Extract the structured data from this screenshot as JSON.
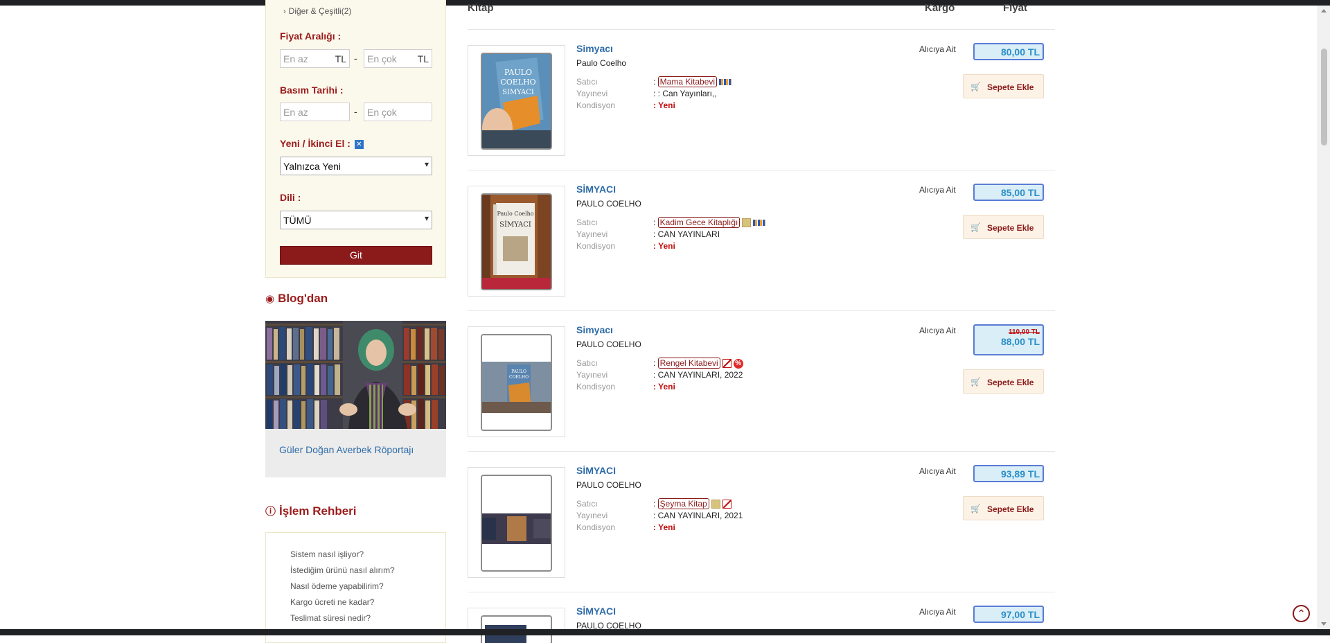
{
  "sidebar": {
    "category_link": "Diğer & Çeşitli(2)",
    "price_label": "Fiyat Aralığı :",
    "price_min_placeholder": "En az",
    "price_max_placeholder": "En çok",
    "currency": "TL",
    "dash": "-",
    "year_label": "Basım Tarihi :",
    "year_min_placeholder": "En az",
    "year_max_placeholder": "En çok",
    "condition_label": "Yeni / İkinci El :",
    "condition_selected": "Yalnızca Yeni",
    "language_label": "Dili :",
    "language_selected": "TÜMÜ",
    "go_button": "Git"
  },
  "blog": {
    "title": "Blog'dan",
    "caption": "Güler Doğan Averbek Röportajı"
  },
  "guide": {
    "title": "İşlem Rehberi",
    "items": [
      "Sistem nasıl işliyor?",
      "İstediğim ürünü nasıl alırım?",
      "Nasıl ödeme yapabilirim?",
      "Kargo ücreti ne kadar?",
      "Teslimat süresi nedir?"
    ]
  },
  "results": {
    "headers": {
      "book": "Kitap",
      "cargo": "Kargo",
      "price": "Fiyat"
    },
    "meta_keys": {
      "seller": "Satıcı",
      "publisher": "Yayınevi",
      "condition": "Kondisyon"
    },
    "cart_label": "Sepete Ekle",
    "items": [
      {
        "title": "Simyacı",
        "author": "Paulo Coelho",
        "seller": "Mama Kitabevi",
        "publisher": ": : Can Yayınları,,",
        "condition": "Yeni",
        "cargo": "Alıcıya Ait",
        "price": "80,00 TL"
      },
      {
        "title": "SİMYACI",
        "author": "PAULO COELHO",
        "seller": "Kadim Gece Kitaplığı",
        "publisher": ": CAN YAYINLARI",
        "condition": "Yeni",
        "cargo": "Alıcıya Ait",
        "price": "85,00 TL"
      },
      {
        "title": "Simyacı",
        "author": "PAULO COELHO",
        "seller": "Rengel Kitabevi",
        "publisher": ": CAN YAYINLARI, 2022",
        "condition": "Yeni",
        "cargo": "Alıcıya Ait",
        "old_price": "110,00 TL",
        "price": "88,00 TL"
      },
      {
        "title": "SİMYACI",
        "author": "PAULO COELHO",
        "seller": "Şeyma Kitap",
        "publisher": ": CAN YAYINLARI, 2021",
        "condition": "Yeni",
        "cargo": "Alıcıya Ait",
        "price": "93,89 TL"
      },
      {
        "title": "SİMYACI",
        "author": "PAULO COELHO",
        "cargo": "Alıcıya Ait",
        "price": "97,00 TL"
      }
    ]
  },
  "colors": {
    "brand_red": "#8b1a1a",
    "link_blue": "#2f6ca8",
    "price_blue": "#2a8ec9"
  }
}
